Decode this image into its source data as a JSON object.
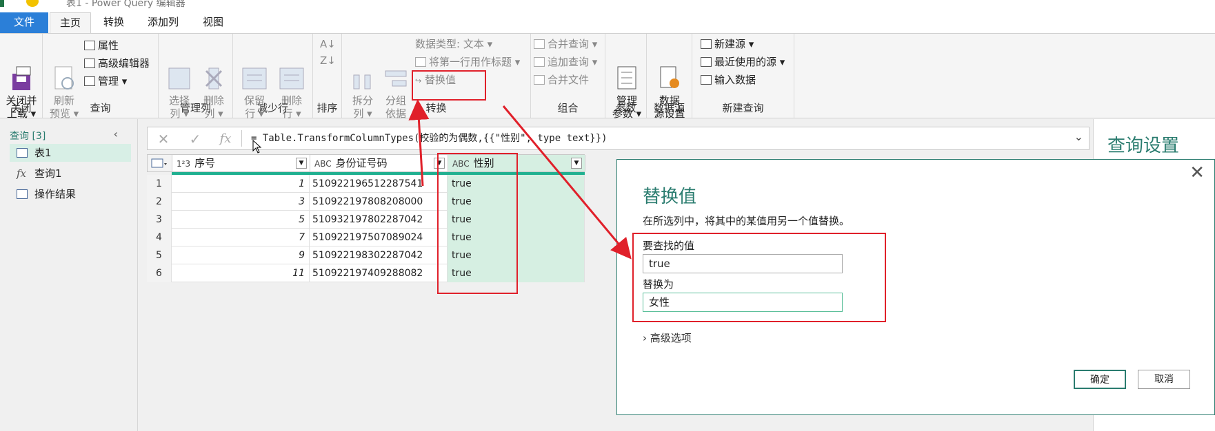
{
  "window": {
    "title": "表1 - Power Query 编辑器"
  },
  "tabs": [
    {
      "label": "文件"
    },
    {
      "label": "主页"
    },
    {
      "label": "转换"
    },
    {
      "label": "添加列"
    },
    {
      "label": "视图"
    }
  ],
  "ribbon": {
    "close_load": "关闭并\n上载 ▾",
    "refresh": "刷新\n预览 ▾",
    "properties": "属性",
    "advanced_editor": "高级编辑器",
    "manage": "管理 ▾",
    "choose_cols": "选择\n列 ▾",
    "remove_cols": "删除\n列 ▾",
    "keep_rows": "保留\n行 ▾",
    "remove_rows": "删除\n行 ▾",
    "split_col": "拆分\n列 ▾",
    "group_by": "分组\n依据",
    "data_type": "数据类型: 文本 ▾",
    "first_row_header": "将第一行用作标题 ▾",
    "replace_values": "替换值",
    "merge_queries": "合并查询 ▾",
    "append_queries": "追加查询 ▾",
    "combine_files": "合并文件",
    "manage_params": "管理\n参数 ▾",
    "data_source_settings": "数据\n源设置",
    "new_source": "新建源 ▾",
    "recent_sources": "最近使用的源 ▾",
    "enter_data": "输入数据",
    "groups": {
      "close": "关闭",
      "query": "查询",
      "manage_cols": "管理列",
      "reduce_rows": "减少行",
      "sort": "排序",
      "transform": "转换",
      "combine": "组合",
      "params": "参数",
      "data_source": "数据源",
      "new_query": "新建查询"
    }
  },
  "queries": {
    "header": "查询 [3]",
    "items": [
      {
        "label": "表1"
      },
      {
        "label": "查询1"
      },
      {
        "label": "操作结果"
      }
    ]
  },
  "formula": {
    "cancel_glyph": "✕",
    "confirm_glyph": "✓",
    "fx_glyph": "fx",
    "text": "= Table.TransformColumnTypes(校验的为偶数,{{\"性别\", type text}})"
  },
  "table": {
    "columns": [
      {
        "type": "1²3",
        "name": "序号"
      },
      {
        "type": "ABC",
        "name": "身份证号码"
      },
      {
        "type": "ABC",
        "name": "性别"
      }
    ],
    "rows": [
      {
        "idx": "1",
        "seq": "1",
        "id": "510922196512287541",
        "sex": "true"
      },
      {
        "idx": "2",
        "seq": "3",
        "id": "510922197808208000",
        "sex": "true"
      },
      {
        "idx": "3",
        "seq": "5",
        "id": "510932197802287042",
        "sex": "true"
      },
      {
        "idx": "4",
        "seq": "7",
        "id": "510922197507089024",
        "sex": "true"
      },
      {
        "idx": "5",
        "seq": "9",
        "id": "510922198302287042",
        "sex": "true"
      },
      {
        "idx": "6",
        "seq": "11",
        "id": "510922197409288082",
        "sex": "true"
      }
    ]
  },
  "settings": {
    "title": "查询设置"
  },
  "dialog": {
    "title": "替换值",
    "description": "在所选列中，将其中的某值用另一个值替换。",
    "find_label": "要查找的值",
    "find_value": "true",
    "replace_label": "替换为",
    "replace_value": "女性",
    "advanced": "高级选项",
    "ok": "确定",
    "cancel": "取消",
    "close_glyph": "✕"
  },
  "colors": {
    "accent": "#2a7c6f",
    "annotation": "#e0202a",
    "file_tab": "#2b7fd8"
  }
}
